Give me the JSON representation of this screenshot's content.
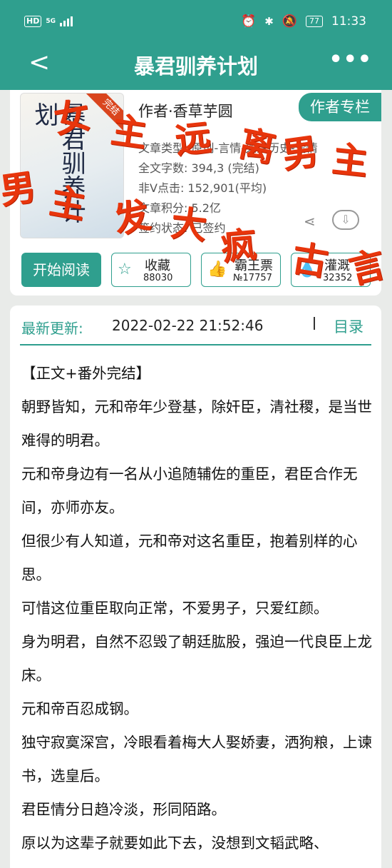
{
  "status": {
    "hd": "HD",
    "network": "5G",
    "battery": "77",
    "time": "11:33"
  },
  "header": {
    "back": "<",
    "title": "暴君驯养计划",
    "more": "•••"
  },
  "book": {
    "cover_title": "暴君驯养计划",
    "cover_badge": "完结",
    "author": "作者·香草芋圆",
    "author_button": "作者专栏",
    "meta": [
      "文章类型: 原创-言情-架空历史-爱情",
      "全文字数: 394,3 (完结)",
      "非V点击: 152,901(平均)",
      "文章积分: 5.2亿",
      "签约状态: 已签约"
    ],
    "read_button": "开始阅读",
    "stats": [
      {
        "label": "收藏",
        "value": "88030",
        "icon": "star-icon"
      },
      {
        "label": "霸王票",
        "value": "№17757",
        "icon": "thumb-icon"
      },
      {
        "label": "灌溉",
        "value": "32352",
        "icon": "water-icon"
      }
    ]
  },
  "update": {
    "label": "最新更新:",
    "date": "2022-02-22 21:52:46",
    "toc": "目录"
  },
  "body": [
    "【正文+番外完结】",
    "朝野皆知，元和帝年少登基，除奸臣，清社稷，是当世难得的明君。",
    "元和帝身边有一名从小追随辅佐的重臣，君臣合作无间，亦师亦友。",
    "但很少有人知道，元和帝对这名重臣，抱着别样的心思。",
    "可惜这位重臣取向正常，不爱男子，只爱红颜。",
    "身为明君，自然不忍毁了朝廷肱股，强迫一代良臣上龙床。",
    "元和帝百忍成钢。",
    "独守寂寞深宫，冷眼看着梅大人娶娇妻，洒狗粮，上谏书，选皇后。",
    "君臣情分日趋冷淡，形同陌路。",
    "原以为这辈子就要如此下去，没想到文韬武略、"
  ],
  "overlay": {
    "line1": "女主远离男主",
    "line2": "男主发大疯古言"
  },
  "colors": {
    "primary": "#2f9f8e",
    "overlay": "#e8350c"
  }
}
